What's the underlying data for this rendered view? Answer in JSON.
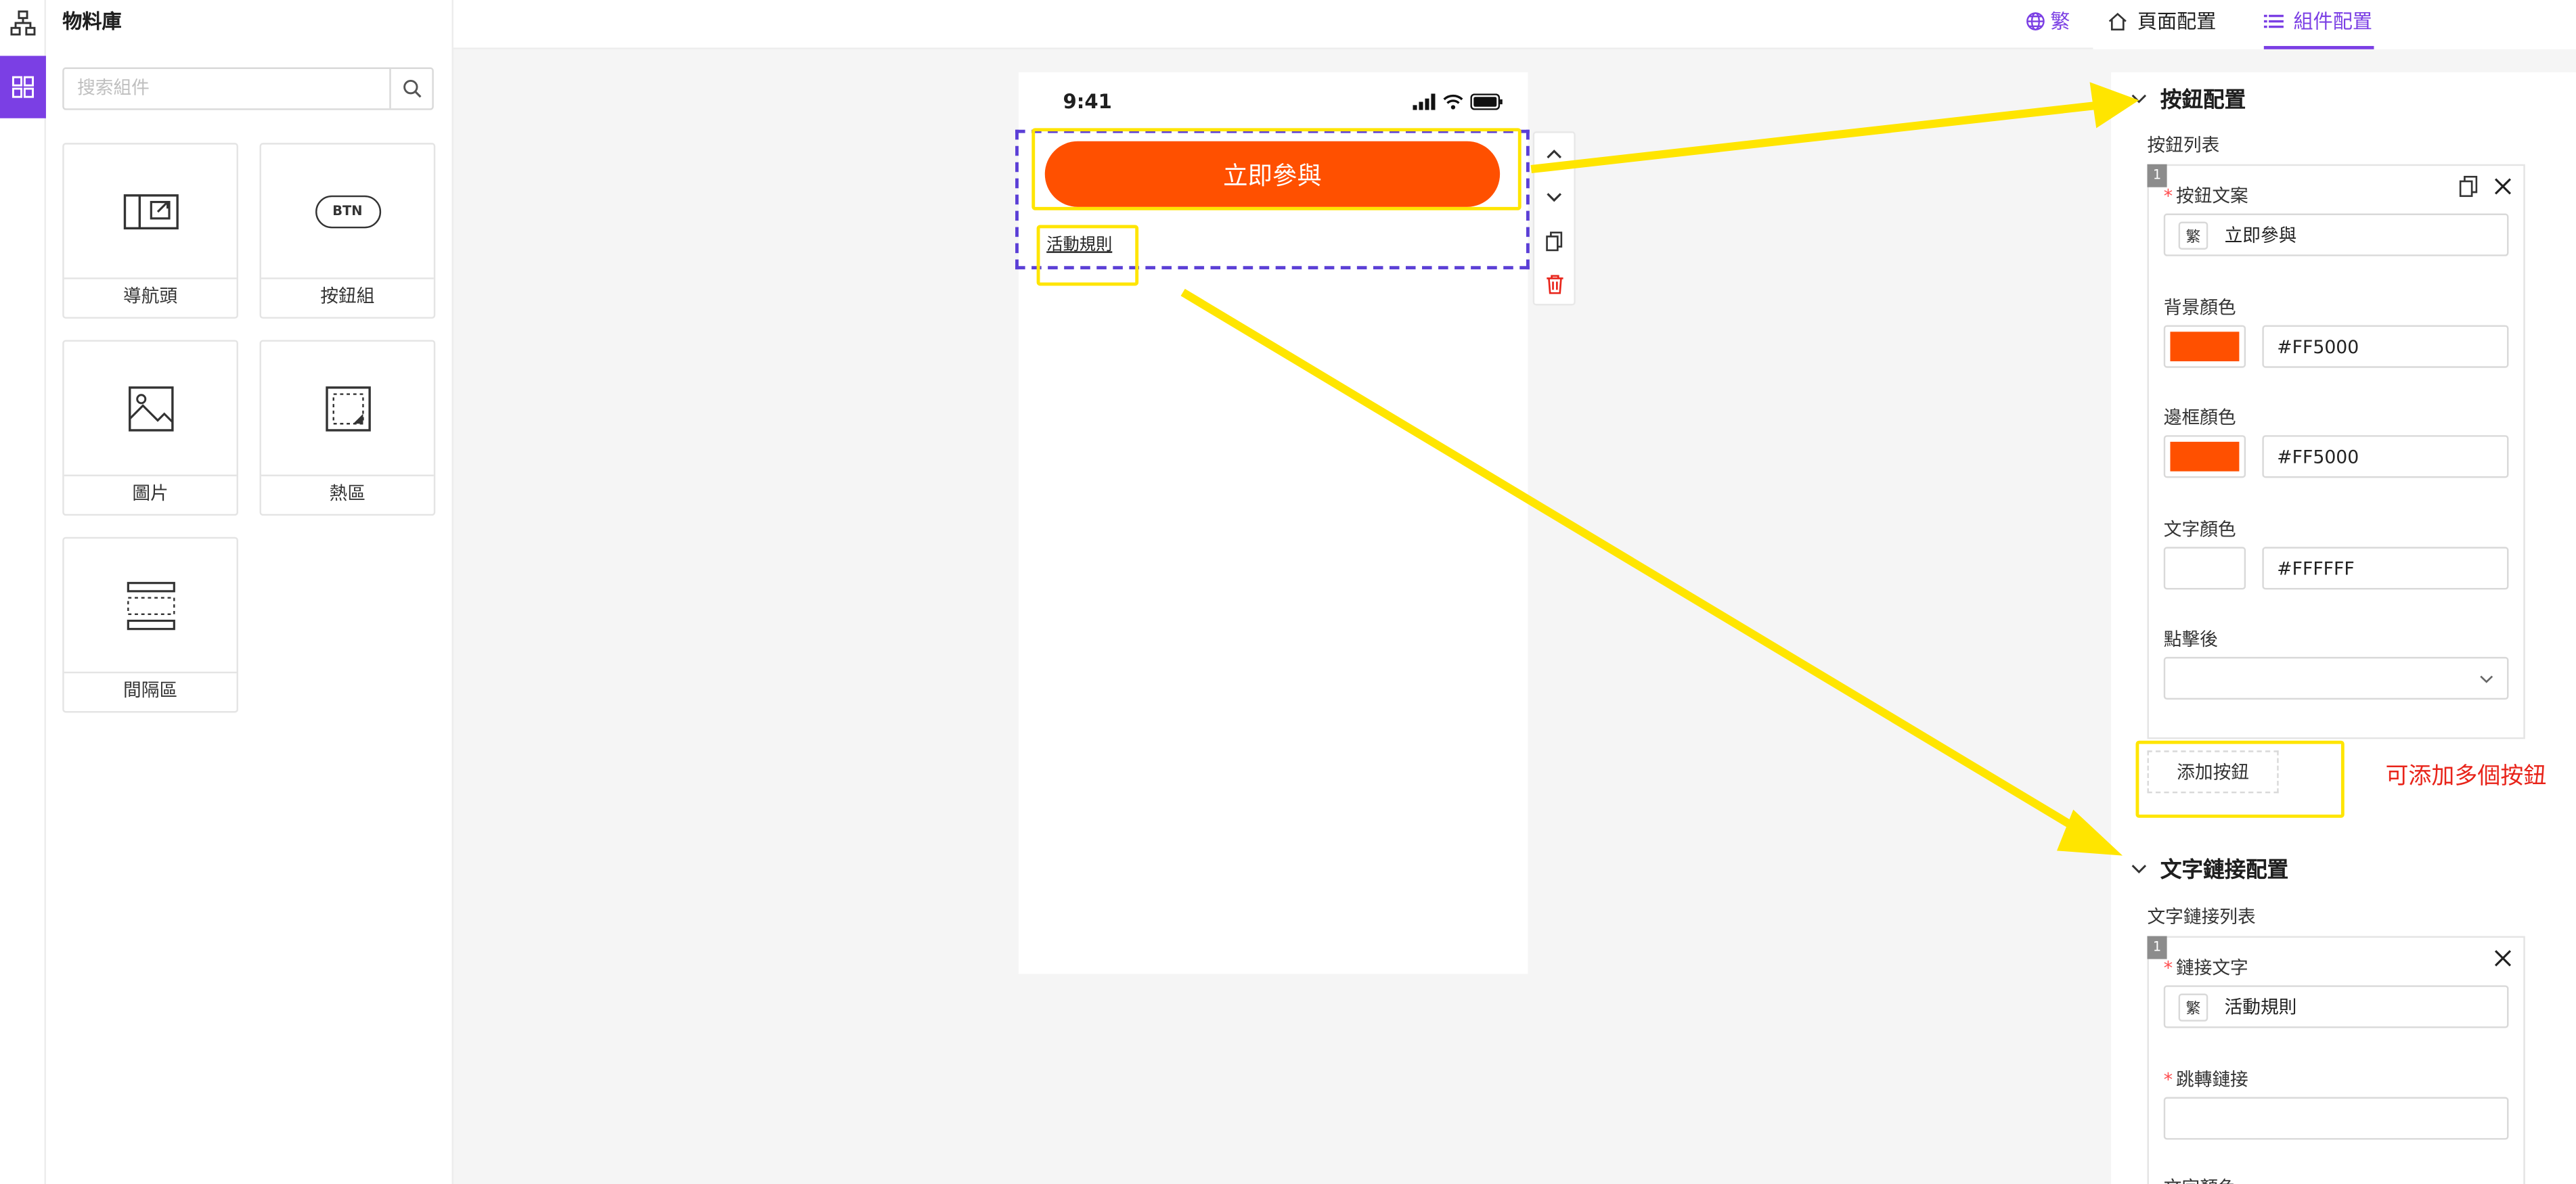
{
  "library": {
    "title": "物料庫",
    "search_placeholder": "搜索組件",
    "items": [
      {
        "label": "導航頭",
        "icon": "nav-header-icon"
      },
      {
        "label": "按鈕組",
        "icon": "button-group-icon",
        "icon_text": "BTN"
      },
      {
        "label": "圖片",
        "icon": "image-icon"
      },
      {
        "label": "熱區",
        "icon": "hotspot-icon"
      },
      {
        "label": "間隔區",
        "icon": "spacer-icon"
      }
    ]
  },
  "topbar": {
    "language": "繁"
  },
  "phone": {
    "time": "9:41",
    "cta_button": "立即參與",
    "text_link": "活動規則"
  },
  "right_panel": {
    "tabs": [
      {
        "label": "頁面配置",
        "icon": "home-icon",
        "active": false
      },
      {
        "label": "組件配置",
        "icon": "list-icon",
        "active": true
      }
    ],
    "button_config": {
      "title": "按鈕配置",
      "list_label": "按鈕列表",
      "item_index": "1",
      "text_label": "按鈕文案",
      "lang_tag": "繁",
      "text_value": "立即參與",
      "bg_label": "背景顏色",
      "bg_value": "#FF5000",
      "border_label": "邊框顏色",
      "border_value": "#FF5000",
      "font_color_label": "文字顏色",
      "font_color_value": "#FFFFFF",
      "on_click_label": "點擊後",
      "on_click_value": "",
      "add_button": "添加按鈕",
      "note": "可添加多個按鈕"
    },
    "link_config": {
      "title": "文字鏈接配置",
      "list_label": "文字鏈接列表",
      "item_index": "1",
      "text_label": "鏈接文字",
      "lang_tag": "繁",
      "text_value": "活動規則",
      "url_label": "跳轉鏈接",
      "url_value": "",
      "color_label_partial": "文字顏色"
    }
  },
  "colors": {
    "accent": "#7b3fe4",
    "cta": "#ff5000",
    "annotation": "#ffe500",
    "note": "#e8241a"
  }
}
